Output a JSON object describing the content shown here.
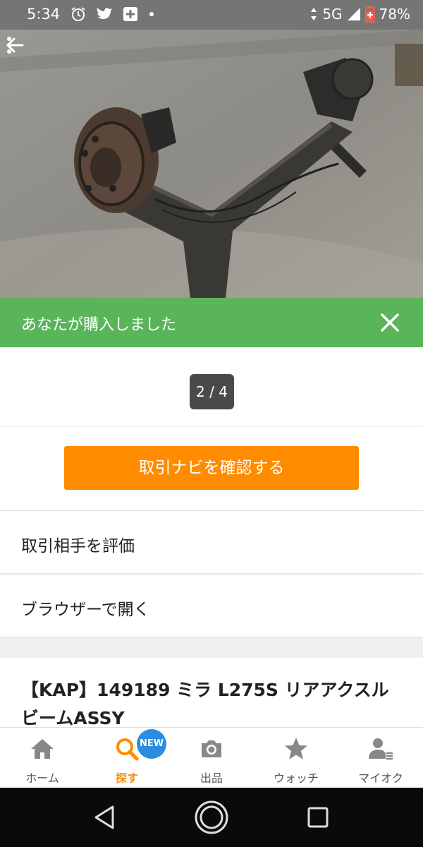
{
  "status_bar": {
    "time": "5:34",
    "network": "5G",
    "battery": "78%",
    "icons": [
      "alarm-icon",
      "twitter-icon",
      "plus-box-icon",
      "dot-icon",
      "data-arrows-icon",
      "signal-icon",
      "battery-icon"
    ]
  },
  "photo": {
    "page_indicator": "2 / 4"
  },
  "banner": {
    "text": "あなたが購入しました",
    "color": "#5ab55a"
  },
  "actions": {
    "primary_label": "取引ナビを確認する",
    "primary_color": "#ff8c00",
    "rate_label": "取引相手を評価",
    "browser_label": "ブラウザーで開く"
  },
  "item": {
    "title": "【KAP】149189 ミラ L275S リアアクスルビームASSY"
  },
  "tabs": [
    {
      "label": "ホーム",
      "icon": "home-icon",
      "active": false
    },
    {
      "label": "探す",
      "icon": "search-icon",
      "active": true,
      "badge": "NEW"
    },
    {
      "label": "出品",
      "icon": "camera-icon",
      "active": false
    },
    {
      "label": "ウォッチ",
      "icon": "star-icon",
      "active": false
    },
    {
      "label": "マイオク",
      "icon": "user-list-icon",
      "active": false
    }
  ],
  "accent_color": "#ff8c00",
  "badge_color": "#2a8de0"
}
